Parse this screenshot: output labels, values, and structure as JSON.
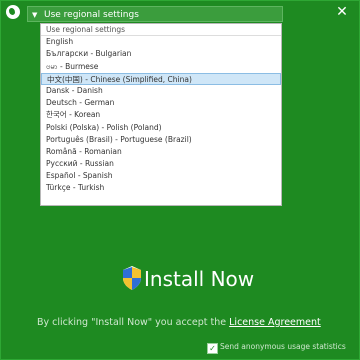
{
  "titlebar": {
    "close_label": "✕"
  },
  "language_select": {
    "value": "Use regional settings",
    "options": [
      "Use regional settings",
      "English",
      "Български - Bulgarian",
      "ဗမာ - Burmese",
      "中文(中国) - Chinese (Simplified, China)",
      "Dansk - Danish",
      "Deutsch - German",
      "한국어 - Korean",
      "Polski (Polska) - Polish (Poland)",
      "Português (Brasil) - Portuguese (Brazil)",
      "Română - Romanian",
      "Русский - Russian",
      "Español - Spanish",
      "Türkçe - Turkish"
    ],
    "selected_index": 4
  },
  "install": {
    "label": "Install Now"
  },
  "agreement": {
    "prefix": "By clicking \"Install Now\" you accept the ",
    "link": "License Agreement"
  },
  "stats": {
    "label": "Send anonymous usage statistics",
    "checked": true
  },
  "colors": {
    "background": "#1f8a22",
    "selection": "#cfe6f7"
  }
}
